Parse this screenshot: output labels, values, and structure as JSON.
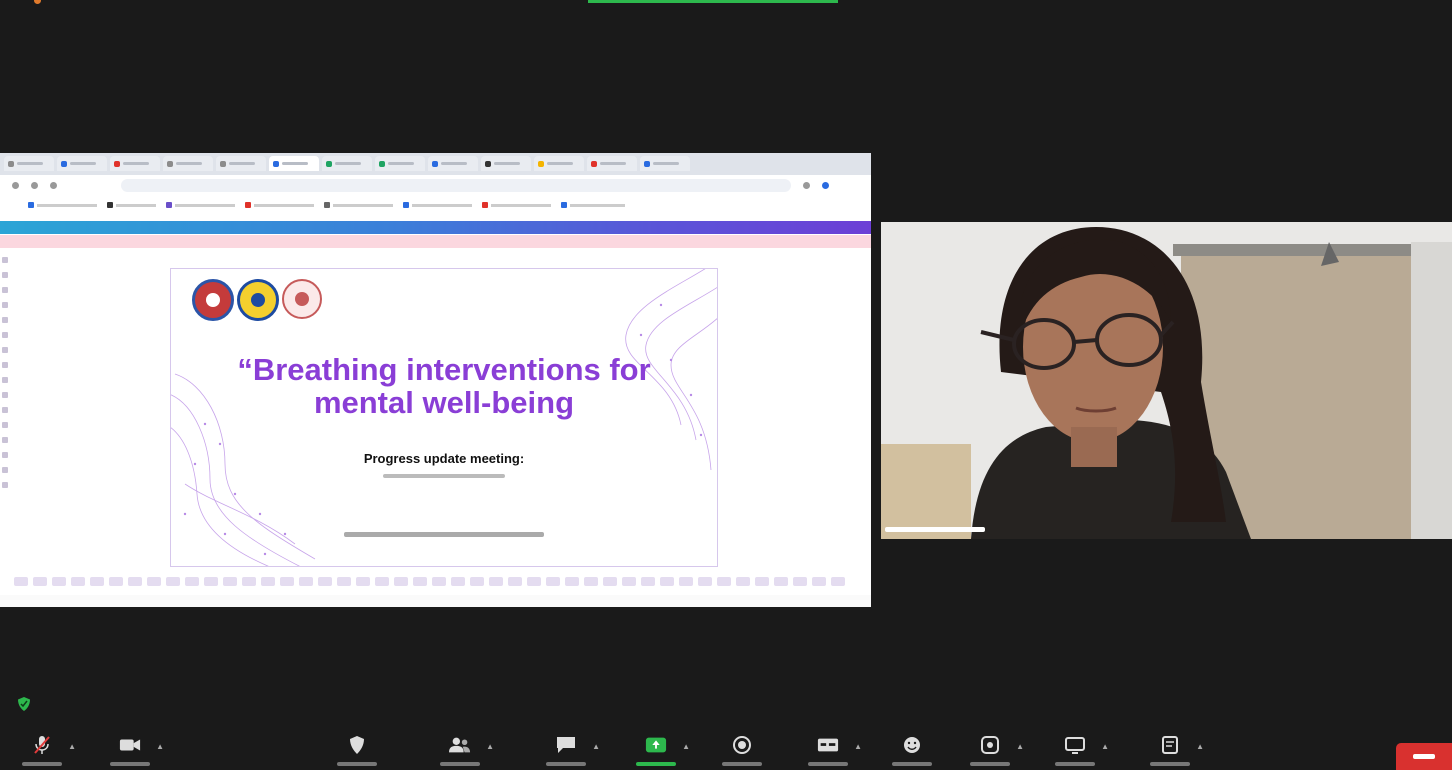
{
  "slide": {
    "title_line1": "“Breathing interventions for",
    "title_line2": "mental well-being",
    "subtitle": "Progress update meeting:"
  },
  "colors": {
    "background": "#1a1a1a",
    "slide_accent": "#8a3ed6",
    "share_green": "#2db84d",
    "end_red": "#d9312f"
  },
  "toolbar": {
    "icons": [
      "mic-muted-icon",
      "video-icon",
      "security-icon",
      "participants-icon",
      "chat-icon",
      "share-screen-icon",
      "record-icon",
      "captions-icon",
      "reactions-icon",
      "apps-icon",
      "whiteboards-icon",
      "notes-icon"
    ]
  }
}
